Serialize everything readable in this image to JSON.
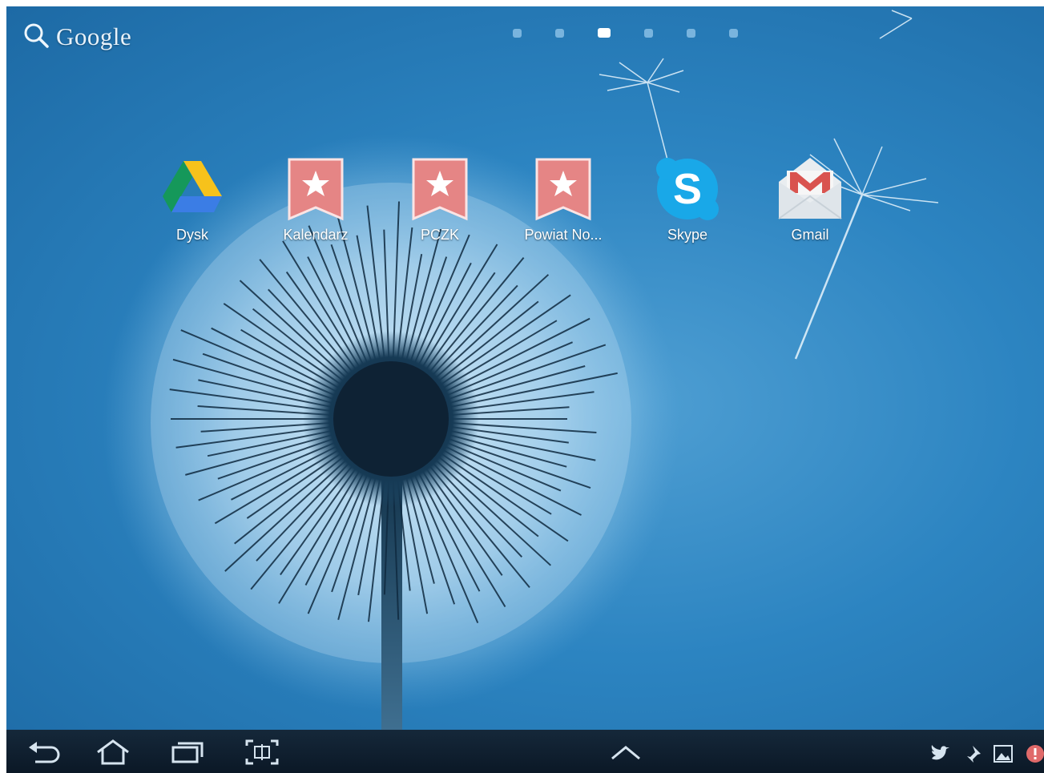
{
  "search": {
    "label": "Google",
    "icon": "search-icon"
  },
  "pages": {
    "count": 6,
    "active_index": 2
  },
  "apps": [
    {
      "label": "Dysk",
      "icon": "google-drive-icon"
    },
    {
      "label": "Kalendarz",
      "icon": "bookmark-star-icon"
    },
    {
      "label": "PCZK",
      "icon": "bookmark-star-icon"
    },
    {
      "label": "Powiat No...",
      "icon": "bookmark-star-icon"
    },
    {
      "label": "Skype",
      "icon": "skype-icon"
    },
    {
      "label": "Gmail",
      "icon": "gmail-icon"
    }
  ],
  "nav": {
    "buttons": [
      "back-icon",
      "home-icon",
      "recent-apps-icon",
      "screenshot-icon",
      "app-drawer-up-icon"
    ]
  },
  "tray": [
    "twitter-icon",
    "pin-icon",
    "gallery-icon",
    "alert-icon"
  ],
  "colors": {
    "wallpaper_base": "#2c84c1",
    "nav_bar": "#0b1826",
    "bookmark_red": "#e58585",
    "skype_blue": "#19a8e8"
  }
}
